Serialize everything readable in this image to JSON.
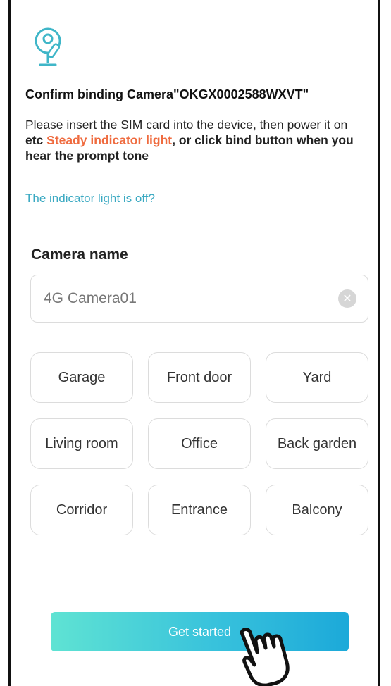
{
  "header": {
    "icon": "camera-icon",
    "title": "Confirm binding  Camera\"OKGX0002588WXVT\""
  },
  "instructions": {
    "line1": "Please insert the SIM card into the device, then power it on",
    "line2_prefix": "etc ",
    "line2_highlight": "Steady indicator light",
    "line2_suffix": ", or click bind button when you hear the prompt tone",
    "help_link": "The indicator light is off?"
  },
  "camera_name": {
    "label": "Camera name",
    "value": "4G Camera01",
    "clear_icon": "clear-icon"
  },
  "name_presets": [
    "Garage",
    "Front door",
    "Yard",
    "Living room",
    "Office",
    "Back garden",
    "Corridor",
    "Entrance",
    "Balcony"
  ],
  "actions": {
    "start_label": "Get started"
  },
  "colors": {
    "accent_orange": "#ef6b3f",
    "link_blue": "#3aa9c2",
    "button_gradient_start": "#5fe3d3",
    "button_gradient_end": "#1ca9d9"
  }
}
